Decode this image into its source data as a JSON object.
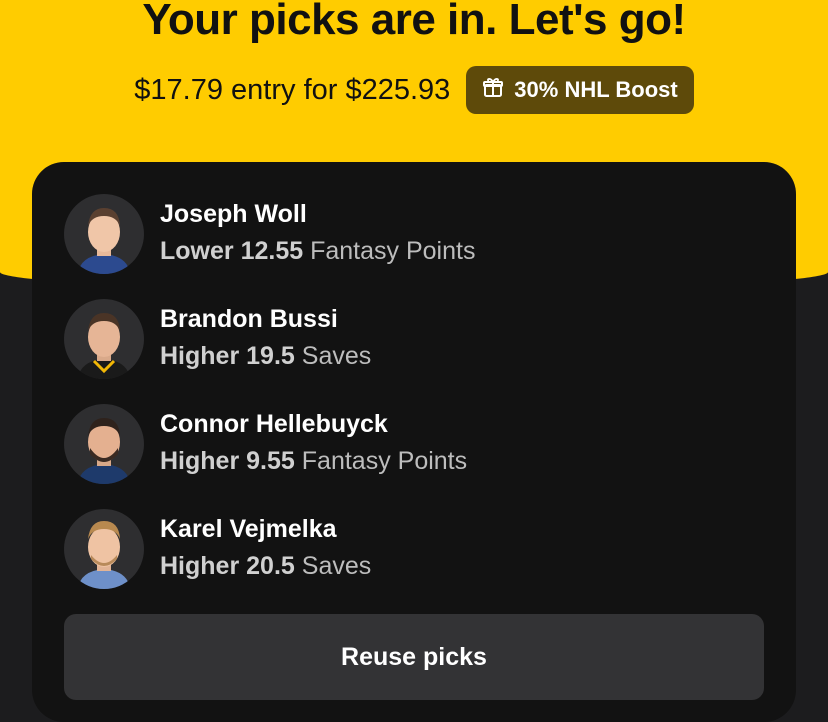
{
  "header": {
    "title": "Your picks are in. Let's go!",
    "entry": "$17.79 entry for $225.93",
    "boost_label": "30% NHL Boost"
  },
  "picks": [
    {
      "name": "Joseph Woll",
      "direction": "Lower",
      "line": "12.55",
      "stat": "Fantasy Points",
      "jersey_color": "#2c4a8f"
    },
    {
      "name": "Brandon Bussi",
      "direction": "Higher",
      "line": "19.5",
      "stat": "Saves",
      "jersey_color": "#1a1a1a"
    },
    {
      "name": "Connor Hellebuyck",
      "direction": "Higher",
      "line": "9.55",
      "stat": "Fantasy Points",
      "jersey_color": "#1e3a6b"
    },
    {
      "name": "Karel Vejmelka",
      "direction": "Higher",
      "line": "20.5",
      "stat": "Saves",
      "jersey_color": "#6e90c9"
    }
  ],
  "actions": {
    "reuse_label": "Reuse picks"
  },
  "colors": {
    "brand_yellow": "#ffcc00",
    "card_bg": "#121212",
    "badge_bg": "#5e4a0a",
    "button_bg": "#333335"
  }
}
